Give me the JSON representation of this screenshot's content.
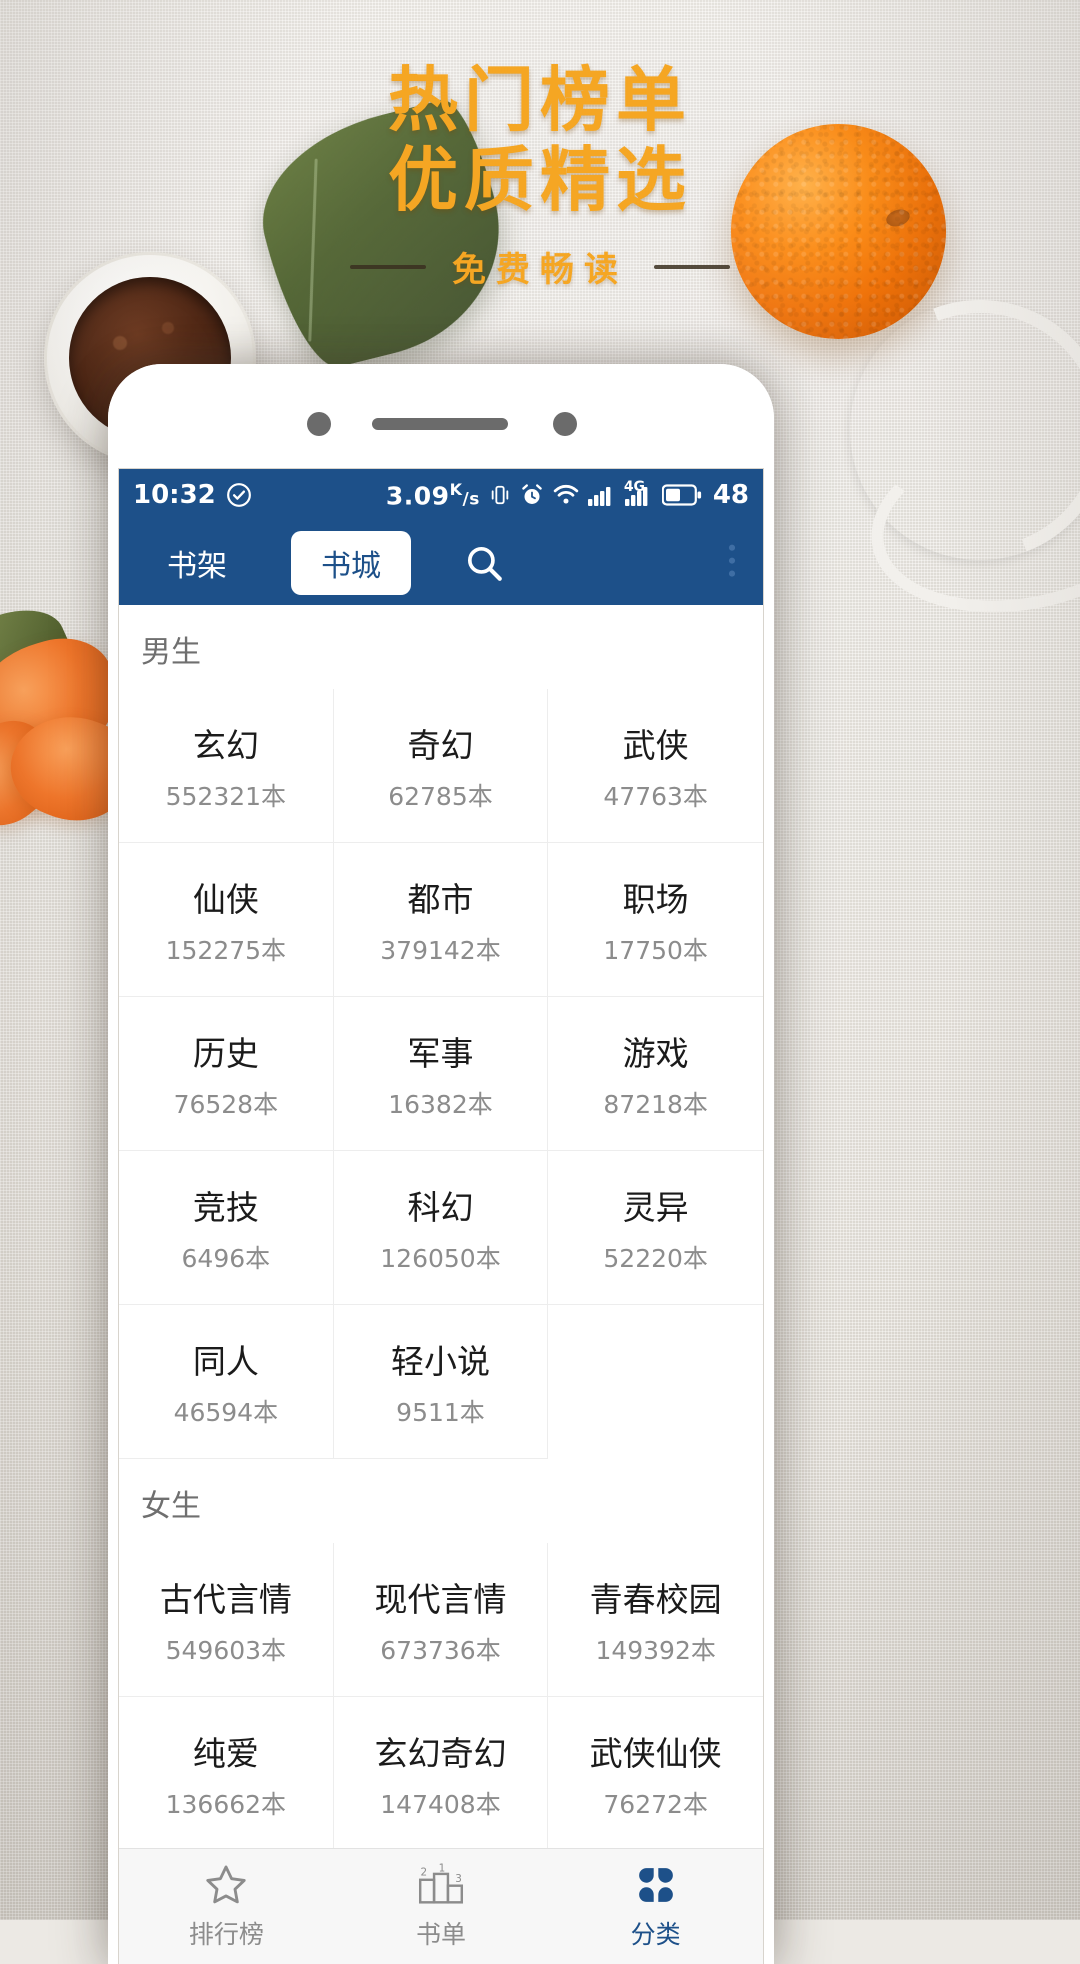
{
  "banner": {
    "line1": "热门榜单",
    "line2": "优质精选",
    "subtitle": "免费畅读"
  },
  "statusbar": {
    "time": "10:32",
    "check_icon": "check-circle-icon",
    "net_speed": "3.09",
    "net_unit_k": "K",
    "net_unit_s": "/s",
    "vibrate_icon": "vibrate-icon",
    "alarm_icon": "alarm-clock-icon",
    "wifi_icon": "wifi-icon",
    "signal_icon": "signal-bars-icon",
    "signal_4g_label": "4G",
    "signal2_icon": "signal-bars-icon",
    "battery_icon": "battery-icon",
    "battery_level": "48"
  },
  "appbar": {
    "tab_shelf": "书架",
    "tab_store": "书城",
    "search_icon": "search-icon",
    "more_icon": "more-vertical-icon"
  },
  "sections": [
    {
      "title": "男生",
      "items": [
        {
          "name": "玄幻",
          "count": "552321本"
        },
        {
          "name": "奇幻",
          "count": "62785本"
        },
        {
          "name": "武侠",
          "count": "47763本"
        },
        {
          "name": "仙侠",
          "count": "152275本"
        },
        {
          "name": "都市",
          "count": "379142本"
        },
        {
          "name": "职场",
          "count": "17750本"
        },
        {
          "name": "历史",
          "count": "76528本"
        },
        {
          "name": "军事",
          "count": "16382本"
        },
        {
          "name": "游戏",
          "count": "87218本"
        },
        {
          "name": "竞技",
          "count": "6496本"
        },
        {
          "name": "科幻",
          "count": "126050本"
        },
        {
          "name": "灵异",
          "count": "52220本"
        },
        {
          "name": "同人",
          "count": "46594本"
        },
        {
          "name": "轻小说",
          "count": "9511本"
        }
      ]
    },
    {
      "title": "女生",
      "items": [
        {
          "name": "古代言情",
          "count": "549603本"
        },
        {
          "name": "现代言情",
          "count": "673736本"
        },
        {
          "name": "青春校园",
          "count": "149392本"
        },
        {
          "name": "纯爱",
          "count": "136662本"
        },
        {
          "name": "玄幻奇幻",
          "count": "147408本"
        },
        {
          "name": "武侠仙侠",
          "count": "76272本"
        }
      ]
    }
  ],
  "bottomnav": [
    {
      "label": "排行榜",
      "icon": "star-icon",
      "active": false
    },
    {
      "label": "书单",
      "icon": "podium-icon",
      "active": false
    },
    {
      "label": "分类",
      "icon": "category-grid-icon",
      "active": true
    }
  ],
  "colors": {
    "brand_blue": "#1d5089",
    "banner_gold": "#f5a623",
    "muted_text": "#8c8c8c"
  }
}
